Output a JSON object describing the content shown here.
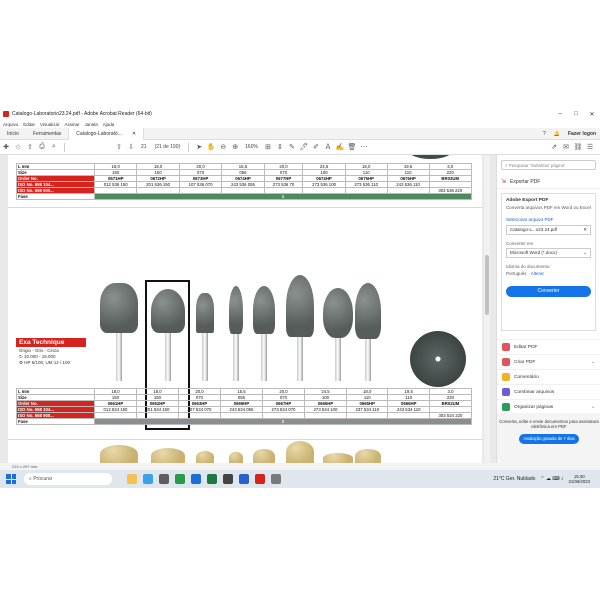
{
  "window": {
    "title": "Catalogo-Laboratorio23.24.pdf - Adobe Acrobat Reader (64-bit)",
    "minimize": "–",
    "maximize": "□",
    "close": "✕"
  },
  "menu": [
    "Arquivo",
    "Editar",
    "Visualizar",
    "Assinar",
    "Janela",
    "Ajuda"
  ],
  "tabs": {
    "home": "Início",
    "tools": "Ferramentas",
    "document": "Catalogo-Laborató...",
    "login": "Fazer logon"
  },
  "toolbar": {
    "page_current": "21",
    "page_info": "(21 de 190)",
    "zoom": "160%"
  },
  "table_top": {
    "rows": [
      {
        "label": "L mm",
        "values": [
          "18,0",
          "18,0",
          "20,0",
          "15,5",
          "20,0",
          "24,5",
          "18,0",
          "19,5",
          "3,0"
        ]
      },
      {
        "label": "Size",
        "values": [
          "150",
          "150",
          "070",
          "055",
          "070",
          "100",
          "110",
          "110",
          "220"
        ]
      },
      {
        "label": "Order No.",
        "values": [
          "0671HP",
          "0672HP",
          "0673HP",
          "0674HP",
          "0677HP",
          "0674HP",
          "0675HP",
          "0676HP",
          "BR03UM"
        ]
      },
      {
        "label": "ISO No. 658 104...",
        "values": [
          "012 536 150",
          "201 536 150",
          "107 536 070",
          "243 536 055",
          "273 536 70",
          "273 536 100",
          "273 536 110",
          "243 536 110",
          ""
        ]
      },
      {
        "label": "ISO No. 658 900...",
        "values": [
          "",
          "",
          "",
          "",
          "",
          "",
          "",
          "",
          "303 536 220"
        ]
      },
      {
        "label": "Fase",
        "values": [
          "1"
        ]
      }
    ]
  },
  "brand": {
    "name": "Exa Technique",
    "colors": "Grigio - Gris - Cinza",
    "speed": "10.000 - 15.000",
    "grit": "HP 6/100, UM 12 / 100"
  },
  "table_bottom": {
    "rows": [
      {
        "label": "L mm",
        "values": [
          "18,0",
          "18,0",
          "20,0",
          "15,5",
          "20,0",
          "24,5",
          "18,0",
          "19,5",
          "3,0"
        ]
      },
      {
        "label": "Size",
        "values": [
          "150",
          "150",
          "070",
          "055",
          "070",
          "100",
          "110",
          "110",
          "220"
        ]
      },
      {
        "label": "Order No.",
        "values": [
          "0661HP",
          "0662HP",
          "0663HP",
          "0669HP",
          "0667HP",
          "0666HP",
          "0665HP",
          "0666HP",
          "BR02UM"
        ]
      },
      {
        "label": "ISO No. 658 104...",
        "values": [
          "012 534 150",
          "201 534 150",
          "107 534 070",
          "243 534 055",
          "273 534 070",
          "273 534 100",
          "237 534 110",
          "243 534 110",
          ""
        ]
      },
      {
        "label": "ISO No. 658 900...",
        "values": [
          "",
          "",
          "",
          "",
          "",
          "",
          "",
          "",
          "303 534 220"
        ]
      },
      {
        "label": "Fase",
        "values": [
          "2"
        ]
      }
    ]
  },
  "right_panel": {
    "search_placeholder": "Pesquisar 'Substituir página'",
    "export_title": "Exportar PDF",
    "card_title": "Adobe Export PDF",
    "card_desc": "Converta arquivos PDF em Word ou Excel",
    "select_file": "Selecionar arquivo PDF",
    "file_name": "Catalogo-L...o23.24.pdf",
    "convert_to_label": "Converter em",
    "convert_to_value": "Microsoft Word (*.docx)",
    "language_label": "Idioma do documento:",
    "language_value": "Português",
    "language_change": "Alterar",
    "convert_button": "Converter",
    "tools": [
      {
        "label": "Editar PDF",
        "color": "#e4535a"
      },
      {
        "label": "Criar PDF",
        "color": "#e4535a"
      },
      {
        "label": "Comentário",
        "color": "#f0b323"
      },
      {
        "label": "Combinar arquivos",
        "color": "#6b5dd3"
      },
      {
        "label": "Organizar páginas",
        "color": "#2a9d5a"
      }
    ],
    "promo_text": "Converta, edite e envie documentos para assinatura eletrônica em PDF",
    "promo_button": "Avaliação gratuita de 7 dias"
  },
  "status": {
    "dimensions": "210 x 297 mm"
  },
  "taskbar": {
    "search": "Procurar",
    "weather": "21°C  Ger. Nublado",
    "time": "15:40",
    "date": "21/06/2023"
  },
  "colors": {
    "brand_red": "#d6231d",
    "phase1_green": "#4e8a5d",
    "phase2_grey": "#8a8d92",
    "accent_blue": "#1473e6"
  }
}
